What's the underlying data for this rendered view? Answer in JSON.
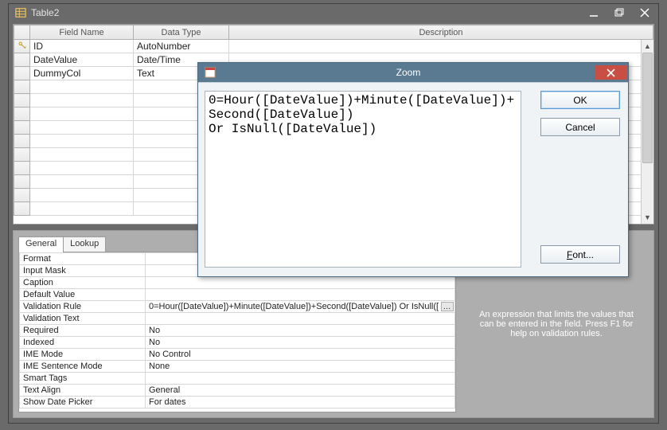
{
  "window": {
    "title": "Table2"
  },
  "grid": {
    "headers": {
      "field": "Field Name",
      "type": "Data Type",
      "desc": "Description"
    },
    "rows": [
      {
        "field": "ID",
        "type": "AutoNumber",
        "pk": true
      },
      {
        "field": "DateValue",
        "type": "Date/Time",
        "pk": false
      },
      {
        "field": "DummyCol",
        "type": "Text",
        "pk": false
      }
    ]
  },
  "tabs": {
    "general": "General",
    "lookup": "Lookup"
  },
  "properties": [
    {
      "name": "Format",
      "value": ""
    },
    {
      "name": "Input Mask",
      "value": ""
    },
    {
      "name": "Caption",
      "value": ""
    },
    {
      "name": "Default Value",
      "value": ""
    },
    {
      "name": "Validation Rule",
      "value": "0=Hour([DateValue])+Minute([DateValue])+Second([DateValue]) Or IsNull([",
      "builder": true
    },
    {
      "name": "Validation Text",
      "value": ""
    },
    {
      "name": "Required",
      "value": "No"
    },
    {
      "name": "Indexed",
      "value": "No"
    },
    {
      "name": "IME Mode",
      "value": "No Control"
    },
    {
      "name": "IME Sentence Mode",
      "value": "None"
    },
    {
      "name": "Smart Tags",
      "value": ""
    },
    {
      "name": "Text Align",
      "value": "General"
    },
    {
      "name": "Show Date Picker",
      "value": "For dates"
    }
  ],
  "help_text": "An expression that limits the values that can be entered in the field. Press F1 for help on validation rules.",
  "zoom": {
    "title": "Zoom",
    "text": "0=Hour([DateValue])+Minute([DateValue])+Second([DateValue])\nOr IsNull([DateValue])",
    "ok": "OK",
    "cancel": "Cancel",
    "font": "Font..."
  }
}
